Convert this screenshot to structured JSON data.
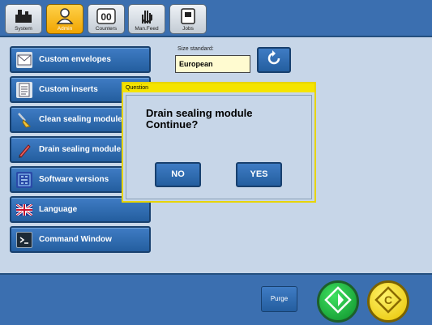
{
  "toolbar": {
    "buttons": [
      {
        "label": "System",
        "icon": "system-icon"
      },
      {
        "label": "Admin",
        "icon": "admin-icon",
        "active": true
      },
      {
        "label": "Counters",
        "icon": "counters-icon"
      },
      {
        "label": "Man.Feed",
        "icon": "manual-feed-icon"
      },
      {
        "label": "Jobs",
        "icon": "jobs-icon"
      }
    ]
  },
  "menu": {
    "items": [
      {
        "label": "Custom envelopes",
        "icon": "envelope-icon"
      },
      {
        "label": "Custom inserts",
        "icon": "insert-icon"
      },
      {
        "label": "Clean sealing module",
        "icon": "brush-icon"
      },
      {
        "label": "Drain sealing module",
        "icon": "pen-icon"
      },
      {
        "label": "Software versions",
        "icon": "chip-icon"
      },
      {
        "label": "Language",
        "icon": "uk-flag-icon"
      },
      {
        "label": "Command Window",
        "icon": "terminal-icon"
      }
    ]
  },
  "size_standard": {
    "label": "Size standard:",
    "value": "European"
  },
  "dialog": {
    "title": "Question",
    "message_line1": "Drain sealing module",
    "message_line2": "Continue?",
    "no_label": "NO",
    "yes_label": "YES"
  },
  "bottom": {
    "purge_label": "Purge"
  },
  "colors": {
    "accent_blue": "#2f6db5",
    "dialog_border": "#e7d400",
    "start_green": "#1db742",
    "clear_yellow": "#f2d600"
  }
}
